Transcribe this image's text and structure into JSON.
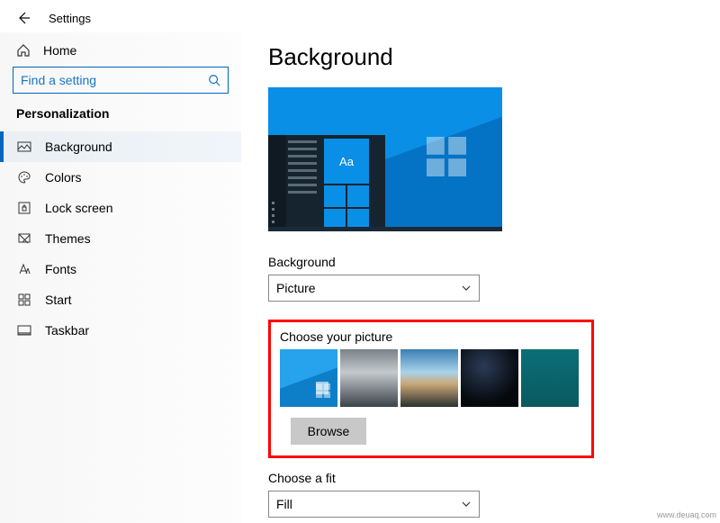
{
  "header": {
    "title": "Settings"
  },
  "sidebar": {
    "home_label": "Home",
    "search_placeholder": "Find a setting",
    "category": "Personalization",
    "items": [
      {
        "label": "Background",
        "active": true
      },
      {
        "label": "Colors"
      },
      {
        "label": "Lock screen"
      },
      {
        "label": "Themes"
      },
      {
        "label": "Fonts"
      },
      {
        "label": "Start"
      },
      {
        "label": "Taskbar"
      }
    ]
  },
  "content": {
    "page_title": "Background",
    "preview_tile_text": "Aa",
    "background_label": "Background",
    "background_value": "Picture",
    "choose_picture_label": "Choose your picture",
    "browse_label": "Browse",
    "choose_fit_label": "Choose a fit",
    "choose_fit_value": "Fill"
  },
  "watermark": "www.deuaq.com"
}
